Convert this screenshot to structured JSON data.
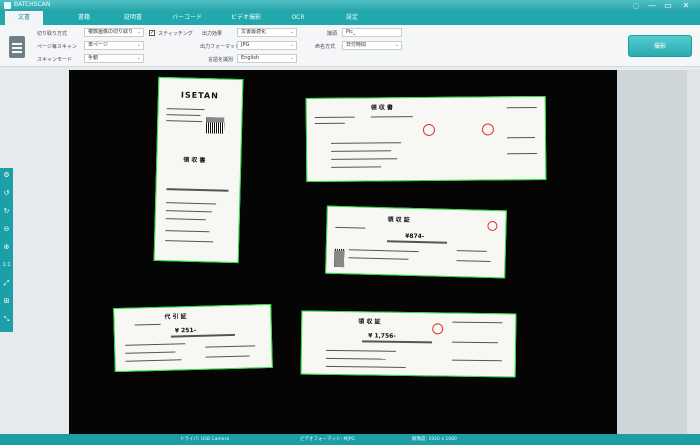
{
  "titlebar": {
    "app_name": "BATCHSCAN",
    "controls": [
      "◌",
      "—",
      "▭",
      "✕"
    ]
  },
  "tabs": [
    {
      "label": "文書",
      "active": true
    },
    {
      "label": "書籍",
      "active": false
    },
    {
      "label": "証明書",
      "active": false
    },
    {
      "label": "バーコード",
      "active": false
    },
    {
      "label": "ビデオ撮影",
      "active": false
    },
    {
      "label": "OCR",
      "active": false
    },
    {
      "label": "設定",
      "active": false
    }
  ],
  "toolbar": {
    "crop_label": "切り取り方式",
    "crop_value": "複数画像の切り取り",
    "page_label": "ページ毎スキャン",
    "page_value": "単ページ",
    "scanmode_label": "スキャンモード",
    "scanmode_value": "手動",
    "stitch_label": "スティッチング",
    "stitch_checked": true,
    "effect_label": "出力効果",
    "effect_value": "文書最適化",
    "format_label": "出力フォーマット",
    "format_value": "JPG",
    "lang_label": "言語を識別",
    "lang_value": "English",
    "prefix_label": "接頭",
    "prefix_value": "Pic_",
    "naming_label": "命名方式",
    "naming_value": "日付時間",
    "scan_button": "撮影"
  },
  "sidetools": [
    "⚙",
    "↺",
    "↻",
    "⊖",
    "⊕",
    "1:1",
    "⤢",
    "⊞",
    "⤡"
  ],
  "receipts": [
    {
      "title": "領 収 書",
      "brand": "ISETAN",
      "amount": ""
    },
    {
      "title": "領 収 書",
      "brand": "",
      "amount": ""
    },
    {
      "title": "領 収 証",
      "brand": "",
      "amount": "¥874-"
    },
    {
      "title": "代 引 証",
      "brand": "",
      "amount": "¥ 251-"
    },
    {
      "title": "領 収 証",
      "brand": "",
      "amount": "¥ 1,756-"
    }
  ],
  "status": {
    "camera": "ドライバ: USB Camera",
    "resolution": "ビデオフォーマット: MJPG",
    "color": "解像度: 1920 x 1080"
  }
}
